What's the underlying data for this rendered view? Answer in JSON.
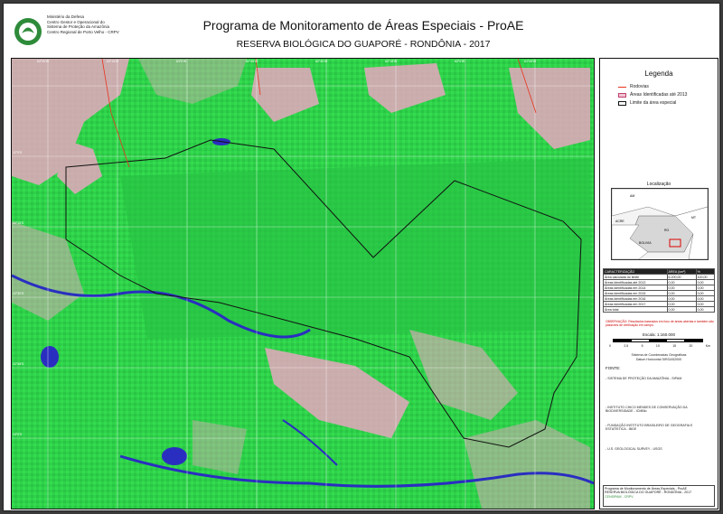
{
  "header": {
    "org_lines": [
      "Ministério da Defesa",
      "Centro Gestor e Operacional do",
      "Sistema de Proteção da Amazônia",
      "Centro Regional de Porto Velho - CRPV"
    ],
    "title": "Programa de Monitoramento de Áreas Especiais - ProAE",
    "subtitle": "RESERVA BIOLÓGICA DO GUAPORÉ - RONDÔNIA - 2017"
  },
  "legend": {
    "title": "Legenda",
    "items": [
      {
        "label": "Rodovias",
        "color": "#e8321e"
      },
      {
        "label": "Áreas Identificadas até 2013",
        "color": "#e6a0b4"
      },
      {
        "label": "Limite da área especial",
        "color": "#111111"
      }
    ]
  },
  "location": {
    "title": "Localização",
    "labels": [
      "AM",
      "MT",
      "BOLIVIA",
      "RO",
      "ACRE"
    ]
  },
  "table": {
    "rows": [
      [
        "CARACTERIZAÇÃO",
        "ÁREA (km²)",
        "%"
      ],
      [
        "Área calculada do limite",
        "6.200,00",
        "100,00"
      ],
      [
        "Áreas identificadas até 2013",
        "0,00",
        "0,00"
      ],
      [
        "Áreas identificadas em 2014",
        "0,00",
        "0,00"
      ],
      [
        "Áreas identificadas em 2015",
        "0,00",
        "0,00"
      ],
      [
        "Áreas identificadas em 2016",
        "0,00",
        "0,00"
      ],
      [
        "Áreas identificadas em 2017",
        "0,00",
        "0,00"
      ],
      [
        "Área total",
        "0,00",
        "0,00"
      ]
    ]
  },
  "note": "OBSERVAÇÃO: Resultados baseados em foco de áreas abertas e também são passíveis de verificação em campo.",
  "scale": {
    "label": "Escala: 1:160.000",
    "ticks": [
      "0",
      "2,5",
      "5",
      "10",
      "15",
      "20"
    ],
    "unit": "Km"
  },
  "datum": [
    "Sistema de Coordenadas Geográficas",
    "Datum Horizontal SIRGAS2000"
  ],
  "fonte_label": "FONTE:",
  "sources": [
    "- SISTEMA DE PROTEÇÃO DA AMAZÔNIA - SIPAM",
    "- INSTITUTO CHICO MENDES DE CONSERVAÇÃO DA BIODIVERSIDADE - ICMBio",
    "- FUNDAÇÃO INSTITUTO BRASILEIRO DE GEOGRAFIA E ESTATÍSTICA - IBGE",
    "- U.S. GEOLOGICAL SURVEY - USGS"
  ],
  "footer": {
    "lines": [
      "Programa de Monitoramento de Áreas Especiais - ProAE",
      "RESERVA BIOLÓGICA DO GUAPORÉ - RONDÔNIA - 2017"
    ],
    "brand": "CENSIPAM - CRPV"
  },
  "map": {
    "grid_labels_top": [
      "63°30'W",
      "63°15'W",
      "63°0'W",
      "62°45'W",
      "62°30'W",
      "62°15'W",
      "62°0'W",
      "61°45'W"
    ],
    "grid_labels_left": [
      "12°0'S",
      "12°15'S",
      "12°30'S",
      "12°45'S",
      "13°0'S"
    ],
    "colors": {
      "forest": "#2fd14a",
      "forest_dark": "#1fa838",
      "cleared": "#e8a7c0",
      "water": "#2a2ec0",
      "boundary": "#111111"
    }
  }
}
